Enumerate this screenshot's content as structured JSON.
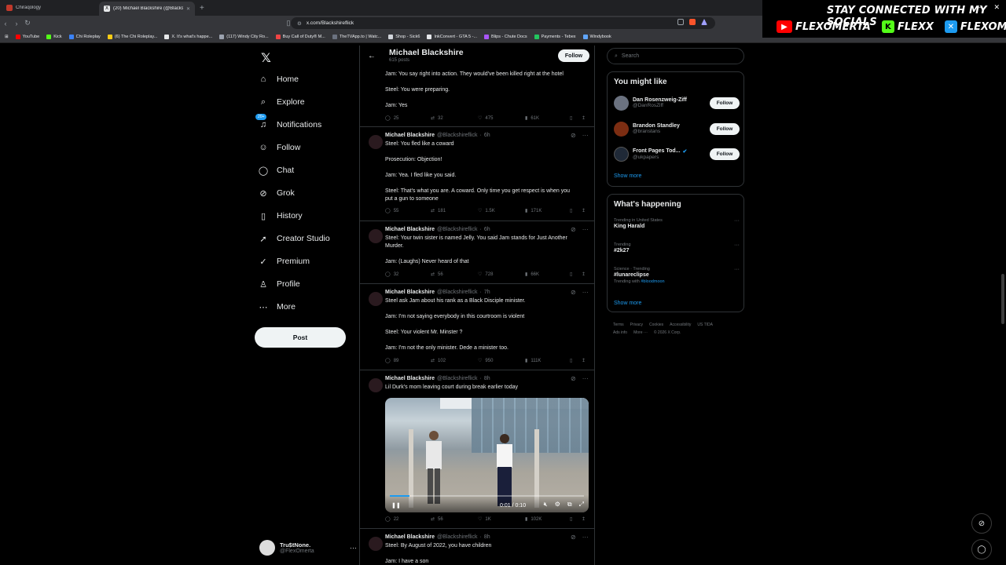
{
  "browser": {
    "tabs": [
      {
        "title": "Chiraqology"
      },
      {
        "title": "(20) Michael Blackshire (@Blacks...",
        "active": true
      }
    ],
    "url": "x.com/Blackshireflick",
    "bookmarks": [
      "YouTube",
      "Kick",
      "Chi Roleplay",
      "(6) The Chi Roleplay...",
      "X. It's what's happe...",
      "(117) Windy City Ro...",
      "Buy Call of Duty® M...",
      "TheTVApp.to | Watc...",
      "Shop - Sick6",
      "InkConvert - GTA 5 -...",
      "Blips - Chute Docs",
      "Payments - Tebex",
      "Windybook"
    ]
  },
  "overlay": {
    "title": "STAY CONNECTED WITH MY SOCIALS",
    "socials": [
      {
        "icon": "youtube-icon",
        "handle": "FLEXOMERTA",
        "color": "#ff0000"
      },
      {
        "icon": "kick-icon",
        "handle": "FLEXX",
        "color": "#53fc18"
      },
      {
        "icon": "x-icon",
        "handle": "FLEXOMERTA",
        "color": "#1d9bf0"
      }
    ]
  },
  "sidebar": {
    "items": [
      {
        "label": "Home",
        "icon": "home-icon"
      },
      {
        "label": "Explore",
        "icon": "search-icon"
      },
      {
        "label": "Notifications",
        "icon": "bell-icon",
        "badge": "20+"
      },
      {
        "label": "Follow",
        "icon": "person-add-icon"
      },
      {
        "label": "Chat",
        "icon": "chat-icon"
      },
      {
        "label": "Grok",
        "icon": "grok-icon"
      },
      {
        "label": "History",
        "icon": "bookmark-icon"
      },
      {
        "label": "Creator Studio",
        "icon": "rocket-icon"
      },
      {
        "label": "Premium",
        "icon": "verified-icon"
      },
      {
        "label": "Profile",
        "icon": "user-icon"
      },
      {
        "label": "More",
        "icon": "more-circle-icon"
      }
    ],
    "post_label": "Post",
    "account": {
      "name": "Tru$tNone.",
      "handle": "@FlexOmerta"
    }
  },
  "profile": {
    "name": "Michael Blackshire",
    "posts": "615 posts",
    "follow_label": "Follow"
  },
  "tweets": [
    {
      "partial": true,
      "lines": [
        "Jam: You say right into action. They would've been killed right at the hotel",
        "Steel: You were preparing.",
        "Jam: Yes"
      ],
      "stats": {
        "replies": "25",
        "reposts": "32",
        "likes": "475",
        "views": "61K"
      }
    },
    {
      "name": "Michael Blackshire",
      "handle": "@Blackshireflick",
      "time": "6h",
      "lines": [
        "Steel: You fled like a coward",
        "Prosecution: Objection!",
        "Jam: Yea. I fled like you said.",
        "Steel: That's what you are. A coward. Only time you get respect is when you",
        "put a gun to someone"
      ],
      "stats": {
        "replies": "55",
        "reposts": "181",
        "likes": "1.5K",
        "views": "171K"
      }
    },
    {
      "name": "Michael Blackshire",
      "handle": "@Blackshireflick",
      "time": "6h",
      "lines": [
        "Steel: Your twin sister is named Jelly. You said Jam stands for Just Another",
        "Murder.",
        "Jam: (Laughs) Never heard of that"
      ],
      "stats": {
        "replies": "32",
        "reposts": "56",
        "likes": "728",
        "views": "66K"
      }
    },
    {
      "name": "Michael Blackshire",
      "handle": "@Blackshireflick",
      "time": "7h",
      "lines": [
        "Steel ask Jam about his rank as a Black Disciple minister.",
        "Jam: I'm not saying everybody in this courtroom is violent",
        "Steel: Your violent Mr. Minster ?",
        "Jam: I'm not the only minister. Dede a minister too."
      ],
      "stats": {
        "replies": "89",
        "reposts": "102",
        "likes": "950",
        "views": "111K"
      }
    },
    {
      "name": "Michael Blackshire",
      "handle": "@Blackshireflick",
      "time": "8h",
      "lines": [
        "Lil Durk's mom leaving court during break earlier today"
      ],
      "video": {
        "time": "0:01 / 0:10",
        "progress": 0.1
      },
      "stats": {
        "replies": "22",
        "reposts": "56",
        "likes": "1K",
        "views": "102K"
      }
    },
    {
      "name": "Michael Blackshire",
      "handle": "@Blackshireflick",
      "time": "8h",
      "lines": [
        "Steel: By August of 2022, you have children",
        "Jam: I have a son"
      ],
      "stats": {}
    }
  ],
  "right": {
    "search_placeholder": "Search",
    "wtf_title": "You might like",
    "suggestions": [
      {
        "name": "Dan Rosenzweig-Ziff",
        "handle": "@DanRosZiff",
        "follow": "Follow"
      },
      {
        "name": "Brandon Standley",
        "handle": "@branstans",
        "follow": "Follow"
      },
      {
        "name": "Front Pages Tod...",
        "handle": "@ukpapers",
        "follow": "Follow",
        "verified": true
      }
    ],
    "show_more": "Show more",
    "happening_title": "What's happening",
    "trends": [
      {
        "context": "Trending in United States",
        "title": "King Harald"
      },
      {
        "context": "Trending",
        "title": "#2k27"
      },
      {
        "context": "Science · Trending",
        "title": "#lunareclipse",
        "sub_prefix": "Trending with",
        "sub_tag": "#bloodmoon"
      }
    ],
    "show_more2": "Show more",
    "footer": [
      "Terms",
      "Privacy",
      "Cookies",
      "Accessibility",
      "US TIDA",
      "Ads info",
      "More ···",
      "© 2026 X Corp."
    ]
  },
  "colors": {
    "accent": "#1d9bf0",
    "bg": "#000000",
    "border": "#2f3336"
  }
}
